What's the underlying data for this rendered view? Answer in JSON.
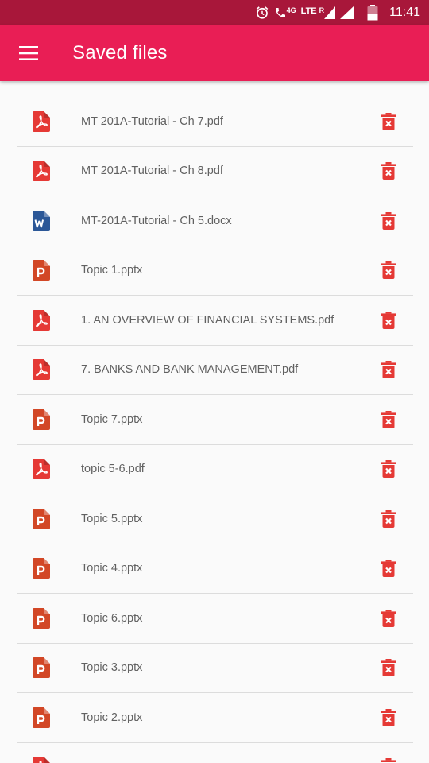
{
  "status_bar": {
    "network_4g": "4G",
    "network_lte": "LTE",
    "roaming": "R",
    "time": "11:41"
  },
  "app_bar": {
    "menu_icon": "hamburger-menu-icon",
    "title": "Saved files"
  },
  "colors": {
    "status_bar": "#a8173a",
    "app_bar": "#e91e55",
    "pdf_icon": "#e53935",
    "docx_icon": "#2b5797",
    "pptx_icon": "#d24726",
    "delete_icon": "#e53935",
    "file_text": "#616161"
  },
  "files": [
    {
      "name": "MT 201A-Tutorial - Ch 7.pdf",
      "type": "pdf"
    },
    {
      "name": "MT 201A-Tutorial - Ch 8.pdf",
      "type": "pdf"
    },
    {
      "name": "MT-201A-Tutorial - Ch 5.docx",
      "type": "docx"
    },
    {
      "name": "Topic 1.pptx",
      "type": "pptx"
    },
    {
      "name": "1. AN OVERVIEW OF FINANCIAL SYSTEMS.pdf",
      "type": "pdf"
    },
    {
      "name": "7. BANKS AND BANK MANAGEMENT.pdf",
      "type": "pdf"
    },
    {
      "name": "Topic 7.pptx",
      "type": "pptx"
    },
    {
      "name": "topic 5-6.pdf",
      "type": "pdf"
    },
    {
      "name": "Topic 5.pptx",
      "type": "pptx"
    },
    {
      "name": "Topic 4.pptx",
      "type": "pptx"
    },
    {
      "name": "Topic 6.pptx",
      "type": "pptx"
    },
    {
      "name": "Topic 3.pptx",
      "type": "pptx"
    },
    {
      "name": "Topic 2.pptx",
      "type": "pptx"
    },
    {
      "name": "",
      "type": "pdf"
    }
  ]
}
